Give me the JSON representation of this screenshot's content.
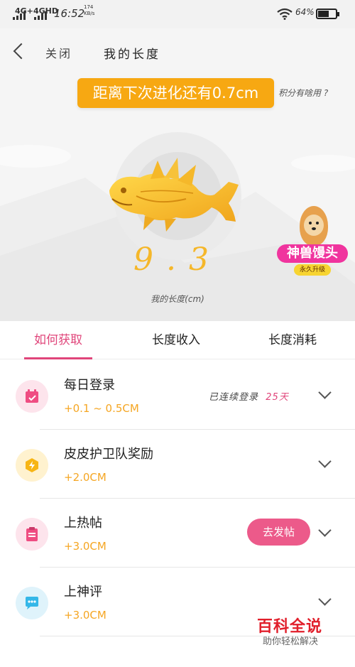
{
  "status_bar": {
    "network_1": "4G+",
    "network_2": "4GHD",
    "time": "16:52",
    "speed_value": "174",
    "speed_unit": "KB/s",
    "battery_percent": "64%",
    "battery_level": 0.64,
    "wifi_icon": "wifi-icon"
  },
  "nav": {
    "close_label": "关闭",
    "title": "我的长度"
  },
  "banner": {
    "text": "距离下次进化还有0.7cm"
  },
  "help_link": "积分有啥用 ?",
  "length": {
    "value": "9.3",
    "label": "我的长度(cm)"
  },
  "badge": {
    "title": "神兽馒头",
    "subtitle": "永久升级"
  },
  "tabs": [
    {
      "label": "如何获取",
      "active": true
    },
    {
      "label": "长度收入",
      "active": false
    },
    {
      "label": "长度消耗",
      "active": false
    }
  ],
  "items": [
    {
      "name": "每日登录",
      "amount": "+0.1 ~ 0.5CM",
      "streak_prefix": "已连续登录",
      "streak_days": "25天",
      "icon": "calendar-icon",
      "icon_bg": "#fde4ec",
      "icon_color": "#ef4d82"
    },
    {
      "name": "皮皮护卫队奖励",
      "amount": "+2.0CM",
      "icon": "shield-bolt-icon",
      "icon_bg": "#fff2cf",
      "icon_color": "#f7b514"
    },
    {
      "name": "上热帖",
      "amount": "+3.0CM",
      "action": "去发帖",
      "icon": "clipboard-icon",
      "icon_bg": "#fde4ec",
      "icon_color": "#ef4d82"
    },
    {
      "name": "上神评",
      "amount": "+3.0CM",
      "icon": "chat-bubble-icon",
      "icon_bg": "#dff3fb",
      "icon_color": "#34b7e8"
    }
  ],
  "watermark": {
    "title": "百科全说",
    "subtitle": "助你轻松解决"
  },
  "colors": {
    "accent_pink": "#e0457a",
    "gold": "#f7a812",
    "amount_orange": "#f5a623"
  }
}
